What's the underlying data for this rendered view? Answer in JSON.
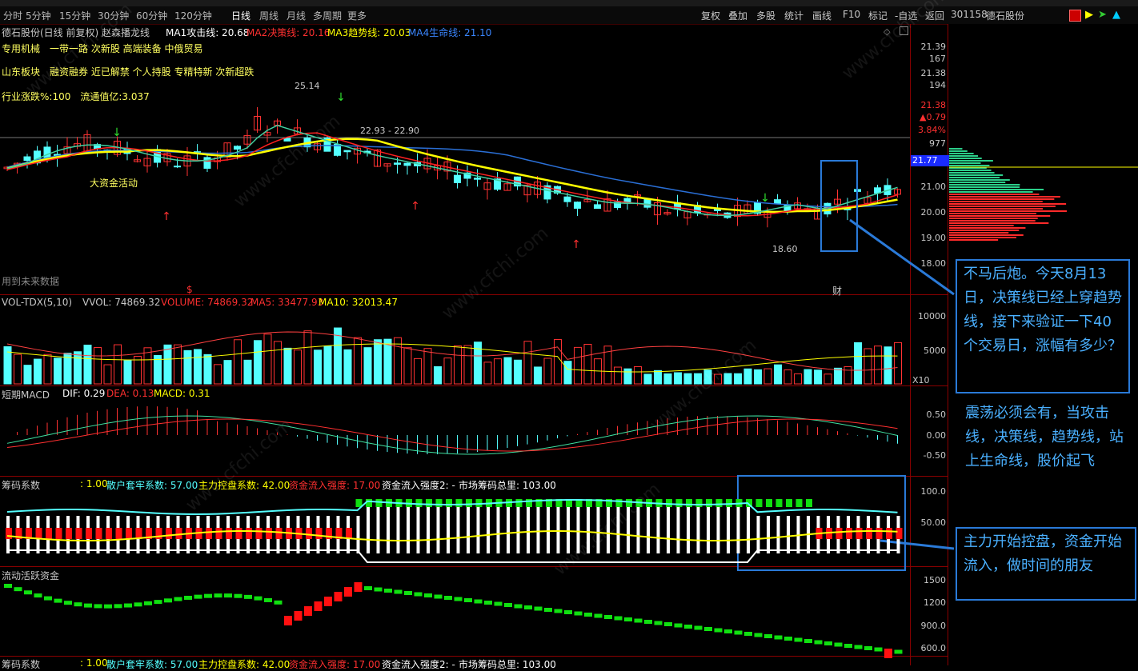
{
  "toolbar": {
    "periods": [
      "分时",
      "5分钟",
      "15分钟",
      "30分钟",
      "60分钟",
      "120分钟",
      "日线",
      "周线",
      "月线",
      "多周期",
      "更多"
    ],
    "selected": "日线",
    "right_buttons": [
      "复权",
      "叠加",
      "多股",
      "统计",
      "画线",
      "F10",
      "标记",
      "-自选",
      "返回"
    ],
    "code": "301158",
    "name": "德石股份"
  },
  "main": {
    "title": "德石股份(日线 前复权)",
    "indicator": "赵森播龙线",
    "ma1": "MA1攻击线: 20.68",
    "ma2": "MA2决策线: 20.16",
    "ma3": "MA3趋势线: 20.03",
    "ma4": "MA4生命线: 21.10",
    "tags1": "专用机械　一带一路 次新股 高端装备 中俄贸易",
    "tags2": "山东板块　融资融券 近已解禁 个人持股 专精特新 次新超跌",
    "tags3": "行业涨跌%:100　流通值亿:3.037",
    "note_big_fund": "大资金活动",
    "note_future": "用到未来数据",
    "high_label": "25.14",
    "low_label": "18.60",
    "mid_label": "22.93 - 22.90",
    "cai": "财",
    "s_mark": "$"
  },
  "price_axis": {
    "labels": [
      "21.39",
      "167",
      "21.38",
      "194",
      "21.38",
      "▲0.79",
      "3.84%",
      "977",
      "21.77",
      "21.00",
      "20.00",
      "19.00",
      "18.00"
    ],
    "current": "21.77"
  },
  "vol": {
    "title": "VOL-TDX(5,10)",
    "vvol": "VVOL: 74869.32",
    "volume": "VOLUME: 74869.32",
    "ma5": "MA5: 33477.93",
    "ma10": "MA10: 32013.47",
    "axis": [
      "10000",
      "5000"
    ],
    "unit": "X10"
  },
  "macd": {
    "title": "短期MACD",
    "dif": "DIF: 0.29",
    "dea": "DEA: 0.13",
    "macd": "MACD: 0.31",
    "axis": [
      "0.50",
      "0.00",
      "-0.50"
    ]
  },
  "chip": {
    "title": "筹码系数",
    "v1": ": 1.00",
    "retail": "散户套牢系数: 57.00",
    "control": "主力控盘系数: 42.00",
    "inflow": "资金流入强度: 17.00",
    "inflow2": "资金流入强度2: -",
    "total": "市场筹码总里: 103.00",
    "axis": [
      "100.0",
      "50.00"
    ]
  },
  "flow": {
    "title": "流动活跃资金",
    "axis": [
      "1500",
      "1200",
      "900.0",
      "600.0"
    ]
  },
  "bottom_row": {
    "title": "筹码系数",
    "v1": ": 1.00",
    "retail": "散户套牢系数: 57.00",
    "control": "主力控盘系数: 42.00",
    "inflow": "资金流入强度: 17.00",
    "inflow2": "资金流入强度2: -",
    "total": "市场筹码总里: 103.00"
  },
  "annotations": {
    "box1": "不马后炮。今天8月13日，决策线已经上穿趋势线，接下来验证一下40个交易日，涨幅有多少？",
    "text2": "震荡必须会有，当攻击线，决策线，趋势线，站上生命线，股价起飞",
    "box3": "主力开始控盘，资金开始流入，做时间的朋友"
  },
  "watermark": "www.cfchi.com",
  "colors": {
    "up": "#ff3232",
    "down": "#54ffff",
    "ma1": "#ffffff",
    "ma2": "#ff2020",
    "ma3": "#ffff00",
    "ma4": "#2a6fd6",
    "annot": "#4ab0ff"
  }
}
